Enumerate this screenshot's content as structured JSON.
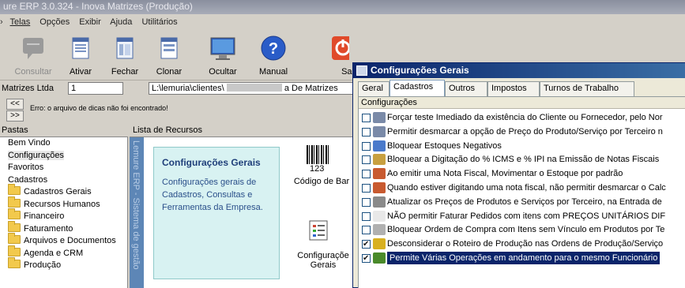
{
  "app": {
    "title": "ure ERP 3.0.324 - Inova Matrizes (Produção)",
    "menu": [
      "Telas",
      "Opções",
      "Exibir",
      "Ajuda",
      "Utilitários"
    ],
    "toolbar": {
      "consultar": "Consultar",
      "ativar": "Ativar",
      "fechar": "Fechar",
      "clonar": "Clonar",
      "ocultar": "Ocultar",
      "manual": "Manual",
      "sair": "Sai"
    },
    "address": {
      "company": "Matrizes Ltda",
      "number": "1",
      "path": "L:\\lemuria\\clientes\\",
      "path_suffix": "a De Matrizes"
    },
    "tip": {
      "prev": "<<",
      "next": ">>",
      "message": "Erro: o arquivo de dicas não foi encontrado!"
    },
    "pastas": {
      "header": "Pastas",
      "items": [
        "Bem Vindo",
        "Configurações",
        "Favoritos",
        "Cadastros"
      ],
      "folders": [
        "Cadastros Gerais",
        "Recursos Humanos",
        "Financeiro",
        "Faturamento",
        "Arquivos e Documentos",
        "Agenda e CRM",
        "Produção"
      ]
    },
    "recursos": {
      "header": "Lista de Recursos",
      "sidebar_text": "Lemure ERP - Sistema de gestão",
      "card_title": "Configurações Gerais",
      "card_desc": "Configurações gerais de Cadastros, Consultas e Ferramentas da Empresa.",
      "barcode_num": "123",
      "barcode_label": "Código de Bar",
      "config_label_1": "Configuraçõe",
      "config_label_2": "Gerais"
    }
  },
  "dialog": {
    "title": "Configurações Gerais",
    "tabs": [
      "Geral",
      "Cadastros",
      "Outros",
      "Impostos",
      "Turnos de Trabalho"
    ],
    "list_header": "Configurações",
    "options": [
      {
        "label": "Forçar teste Imediado da existência do Cliente ou Fornecedor, pelo Nor",
        "checked": false
      },
      {
        "label": "Permitir desmarcar a opção de Preço do Produto/Serviço por Terceiro n",
        "checked": false
      },
      {
        "label": "Bloquear Estoques Negativos",
        "checked": false
      },
      {
        "label": "Bloquear a Digitação do % ICMS e % IPI na Emissão de Notas Fiscais",
        "checked": false
      },
      {
        "label": "Ao emitir uma Nota Fiscal, Movimentar o Estoque por padrão",
        "checked": false
      },
      {
        "label": "Quando estiver digitando uma nota fiscal, não permitir desmarcar o Calc",
        "checked": false
      },
      {
        "label": "Atualizar os Preços de Produtos e Serviços por Terceiro, na Entrada de",
        "checked": false
      },
      {
        "label": "NÃO permitir Faturar Pedidos com itens com PREÇOS UNITÁRIOS DIF",
        "checked": false
      },
      {
        "label": "Bloquear Ordem de Compra com Itens sem Vínculo em Produtos por Te",
        "checked": false
      },
      {
        "label": "Desconsiderar o Roteiro de Produção nas Ordens de Produção/Serviço",
        "checked": true
      },
      {
        "label": "Permite Várias Operações em andamento para o mesmo Funcionário",
        "checked": true
      }
    ]
  }
}
